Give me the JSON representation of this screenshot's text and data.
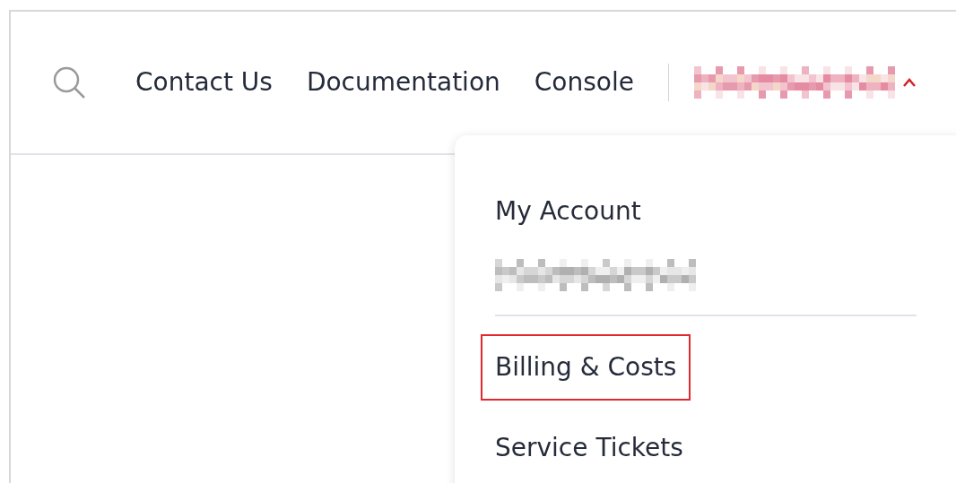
{
  "nav_links": [
    {
      "label": "Contact Us"
    },
    {
      "label": "Documentation"
    },
    {
      "label": "Console"
    }
  ],
  "account_menu": {
    "expanded": true,
    "items": [
      {
        "kind": "heading",
        "label": "My Account"
      },
      {
        "kind": "redacted"
      },
      {
        "kind": "divider"
      },
      {
        "kind": "link",
        "label": "Billing & Costs",
        "highlighted": true
      },
      {
        "kind": "link",
        "label": "Service Tickets",
        "highlighted": false
      }
    ]
  }
}
